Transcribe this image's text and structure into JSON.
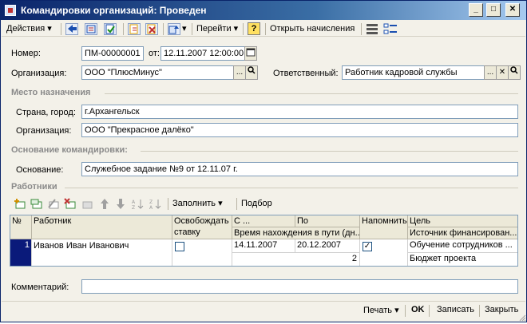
{
  "window": {
    "title": "Командировки организаций: Проведен"
  },
  "toolbar": {
    "actions_label": "Действия",
    "goto_label": "Перейти",
    "help_label": "?",
    "open_accruals_label": "Открыть начисления"
  },
  "header": {
    "number_label": "Номер:",
    "number_value": "ПМ-00000001",
    "date_label": "от:",
    "date_value": "12.11.2007 12:00:00",
    "org_label": "Организация:",
    "org_value": "ООО \"ПлюсМинус\"",
    "responsible_label": "Ответственный:",
    "responsible_value": "Работник кадровой службы"
  },
  "destination": {
    "section_title": "Место назначения",
    "city_label": "Страна, город:",
    "city_value": "г.Архангельск",
    "org_label": "Организация:",
    "org_value": "ООО \"Прекрасное далёко\""
  },
  "basis": {
    "section_title": "Основание командировки:",
    "basis_label": "Основание:",
    "basis_value": "Служебное задание №9 от 12.11.07 г."
  },
  "workers": {
    "section_title": "Работники",
    "fill_label": "Заполнить",
    "select_label": "Подбор",
    "columns": {
      "num": "№",
      "worker": "Работник",
      "release_rate_1": "Освобождать",
      "release_rate_2": "ставку",
      "from": "С ...",
      "to": "По",
      "travel_time": "Время нахождения в пути (дн...",
      "remind": "Напомнить",
      "goal": "Цель",
      "funding": "Источник финансирован..."
    },
    "rows": [
      {
        "num": "1",
        "worker": "Иванов Иван Иванович",
        "release_rate": false,
        "from": "14.11.2007",
        "to": "20.12.2007",
        "travel_days": "2",
        "remind": true,
        "goal": "Обучение сотрудников ...",
        "funding": "Бюджет проекта"
      }
    ]
  },
  "comment": {
    "label": "Комментарий:",
    "value": ""
  },
  "bottom": {
    "print_label": "Печать",
    "ok_label": "OK",
    "save_label": "Записать",
    "close_label": "Закрыть"
  }
}
